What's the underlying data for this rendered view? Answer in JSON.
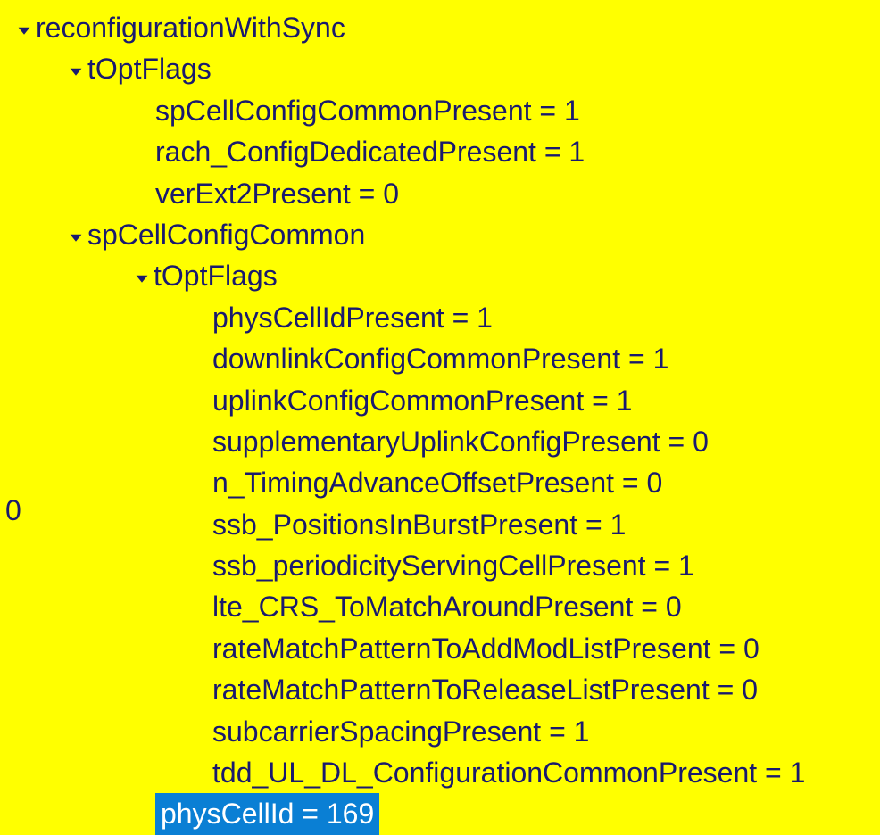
{
  "sideLabel": "0",
  "tree": {
    "reconfigurationWithSync": {
      "label": "reconfigurationWithSync",
      "tOptFlags": {
        "label": "tOptFlags",
        "items": [
          "spCellConfigCommonPresent = 1",
          "rach_ConfigDedicatedPresent = 1",
          "verExt2Present = 0"
        ]
      },
      "spCellConfigCommon": {
        "label": "spCellConfigCommon",
        "tOptFlags": {
          "label": "tOptFlags",
          "items": [
            "physCellIdPresent = 1",
            "downlinkConfigCommonPresent = 1",
            "uplinkConfigCommonPresent = 1",
            "supplementaryUplinkConfigPresent = 0",
            "n_TimingAdvanceOffsetPresent = 0",
            "ssb_PositionsInBurstPresent = 1",
            "ssb_periodicityServingCellPresent = 1",
            "lte_CRS_ToMatchAroundPresent = 0",
            "rateMatchPatternToAddModListPresent = 0",
            "rateMatchPatternToReleaseListPresent = 0",
            "subcarrierSpacingPresent = 1",
            "tdd_UL_DL_ConfigurationCommonPresent = 1"
          ]
        },
        "physCellId": "physCellId = 169"
      }
    }
  }
}
